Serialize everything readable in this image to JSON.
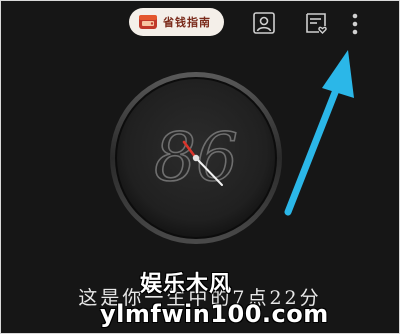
{
  "header": {
    "saver_button_label": "省钱指南"
  },
  "clock": {
    "face_text": "86"
  },
  "caption": {
    "text": "这是你一生中的7点22分"
  },
  "watermark": {
    "site_name": "娱乐木风",
    "url": "ylmfwin100.com"
  },
  "colors": {
    "background": "#161616",
    "pill_background": "#f4efe9",
    "pill_text": "#7a2a1a",
    "arrow": "#2bb7e8",
    "clock_hand_accent": "#d9342b"
  },
  "icons": {
    "saver": "wallet-book-icon",
    "profile": "person-icon",
    "note": "note-heart-icon",
    "more": "more-vertical-icon"
  }
}
